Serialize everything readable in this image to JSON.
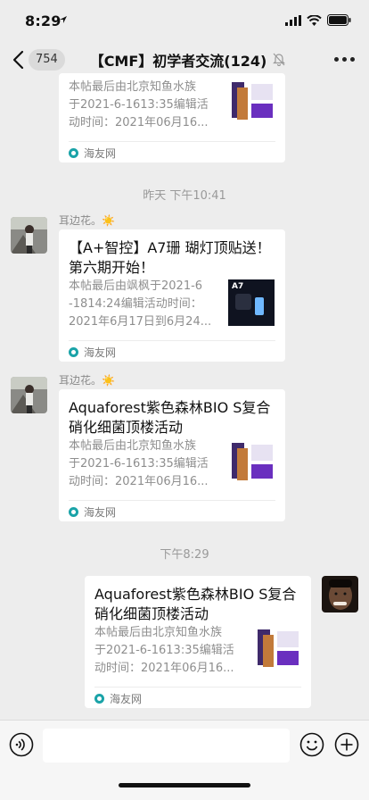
{
  "status_bar": {
    "time": "8:29"
  },
  "nav": {
    "unread_count": "754",
    "title": "【CMF】初学者交流(124)"
  },
  "messages": [
    {
      "desc": "本帖最后由北京知鱼水族\n于2021-6-1613:35编辑活\n动时间：2021年06月16...",
      "source": "海友网"
    },
    {
      "timestamp": "昨天 下午10:41",
      "sender": "耳边花。☀️",
      "title": "【A+智控】A7珊 瑚灯顶贴送！第六期开始！",
      "desc": "本帖最后由飒枫于2021-6\n-1814:24编辑活动时间：\n2021年6月17日到6月24...",
      "thumb_label": "A7",
      "source": "海友网"
    },
    {
      "sender": "耳边花。☀️",
      "title": "Aquaforest紫色森林BIO S复合硝化细菌顶楼活动",
      "desc": "本帖最后由北京知鱼水族\n于2021-6-1613:35编辑活\n动时间：2021年06月16...",
      "source": "海友网"
    },
    {
      "timestamp": "下午8:29",
      "title": "Aquaforest紫色森林BIO S复合硝化细菌顶楼活动",
      "desc": "本帖最后由北京知鱼水族\n于2021-6-1613:35编辑活\n动时间：2021年06月16...",
      "source": "海友网"
    }
  ]
}
